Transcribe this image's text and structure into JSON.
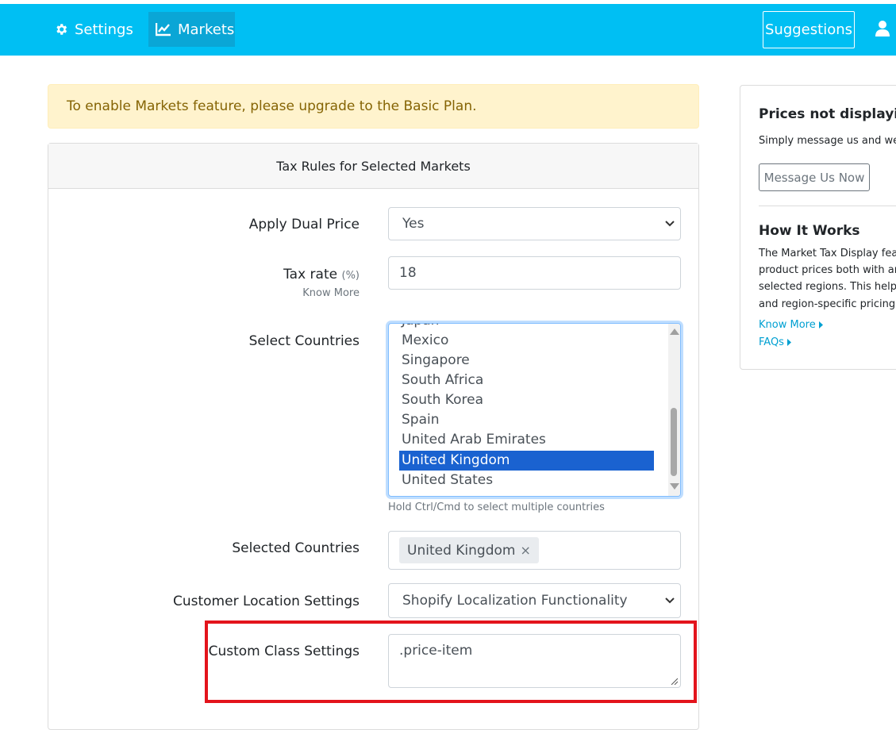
{
  "nav": {
    "settings_label": "Settings",
    "markets_label": "Markets",
    "suggestions_label": "Suggestions",
    "settings_icon": "gear-icon",
    "markets_icon": "line-chart-icon",
    "user_icon": "user-icon"
  },
  "alert": {
    "text": "To enable Markets feature, please upgrade to the Basic Plan."
  },
  "card": {
    "title": "Tax Rules for Selected Markets",
    "apply_dual_price": {
      "label": "Apply Dual Price",
      "value": "Yes"
    },
    "tax_rate": {
      "label": "Tax rate",
      "unit": "(%)",
      "value": "18",
      "know_more": "Know More"
    },
    "select_countries": {
      "label": "Select Countries",
      "partial_option": "Japan",
      "options": [
        "Mexico",
        "Singapore",
        "South Africa",
        "South Korea",
        "Spain",
        "United Arab Emirates",
        "United Kingdom",
        "United States"
      ],
      "selected": "United Kingdom",
      "hint": "Hold Ctrl/Cmd to select multiple countries"
    },
    "selected_countries": {
      "label": "Selected Countries",
      "tags": [
        "United Kingdom"
      ],
      "remove_glyph": "×"
    },
    "customer_location": {
      "label": "Customer Location Settings",
      "value": "Shopify Localization Functionality"
    },
    "custom_class": {
      "label": "Custom Class Settings",
      "value": ".price-item"
    }
  },
  "sidebar": {
    "prices_title": "Prices not displaying",
    "prices_text": "Simply message us and we",
    "message_button": "Message Us Now",
    "how_title": "How It Works",
    "how_lines": [
      "The Market Tax Display feat",
      "product prices both with an",
      "selected regions. This helps",
      "and region-specific pricing"
    ],
    "know_more_link": "Know More",
    "faqs_link": "FAQs"
  },
  "colors": {
    "topbar": "#00bff3",
    "active_nav": "#0aa6d6",
    "alert_bg": "#fff3cd",
    "alert_text": "#856404",
    "selected_option": "#1a62d0",
    "highlight_border": "#e3141c",
    "link": "#00a0d2"
  }
}
